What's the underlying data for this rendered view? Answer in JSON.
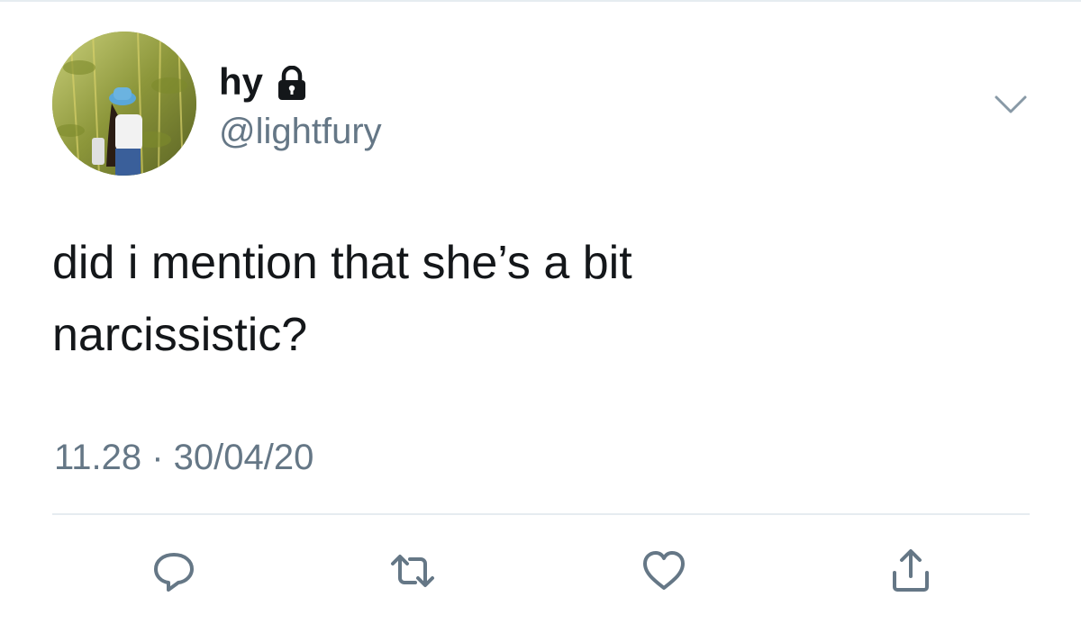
{
  "tweet": {
    "display_name": "hy",
    "handle": "@lightfury",
    "protected": true,
    "text": "did i mention that she’s a bit\nnarcissistic?",
    "timestamp": "11.28 · 30/04/20"
  },
  "icons": {
    "lock": "lock-icon",
    "menu": "chevron-down-icon",
    "reply": "reply-icon",
    "retweet": "retweet-icon",
    "like": "heart-icon",
    "share": "share-icon"
  },
  "colors": {
    "text": "#14171a",
    "secondary": "#657786",
    "divider": "#e6ecf0"
  }
}
